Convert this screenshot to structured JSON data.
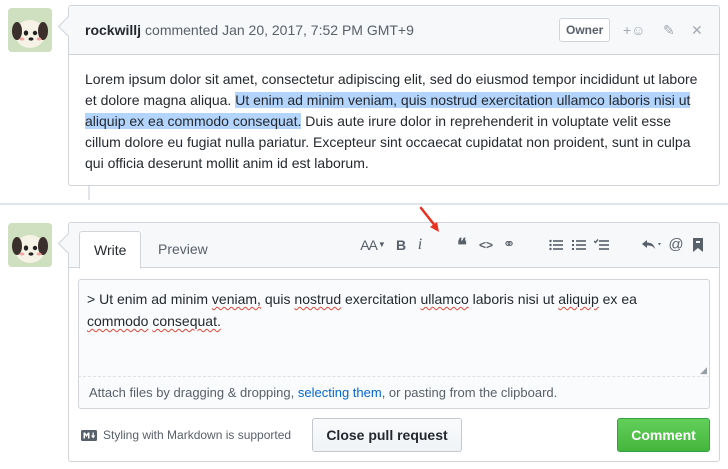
{
  "comment": {
    "author": "rockwillj",
    "meta": "commented Jan 20, 2017, 7:52 PM GMT+9",
    "badge": "Owner",
    "body_before": "Lorem ipsum dolor sit amet, consectetur adipiscing elit, sed do eiusmod tempor incididunt ut labore et dolore magna aliqua. ",
    "body_selected": "Ut enim ad minim veniam, quis nostrud exercitation ullamco laboris nisi ut aliquip ex ea commodo consequat.",
    "body_after": " Duis aute irure dolor in reprehenderit in voluptate velit esse cillum dolore eu fugiat nulla pariatur. Excepteur sint occaecat cupidatat non proident, sunt in culpa qui officia deserunt mollit anim id est laborum.",
    "actions": [
      "add-reaction",
      "edit",
      "delete"
    ],
    "reaction_glyph": "+☺",
    "edit_glyph": "✎",
    "delete_glyph": "✕"
  },
  "editor": {
    "tabs": [
      {
        "label": "Write",
        "active": true
      },
      {
        "label": "Preview",
        "active": false
      }
    ],
    "toolbar": {
      "header_glyph": "AA",
      "bold_glyph": "B",
      "italic_glyph": "i",
      "quote_glyph": "❝",
      "code_glyph": "<>",
      "link_glyph": "⚭",
      "icons": [
        "text-size",
        "bold",
        "italic",
        "quote",
        "code",
        "link",
        "unordered-list",
        "ordered-list",
        "task-list",
        "reply",
        "mention",
        "bookmark"
      ]
    },
    "textarea": {
      "w": [
        ">",
        "Ut",
        "enim",
        "ad",
        "minim",
        "veniam,",
        "quis",
        "nostrud",
        "exercitation",
        "ullamco",
        "laboris",
        "nisi",
        "ut",
        "aliquip",
        "ex",
        "ea",
        "commodo",
        "consequat."
      ]
    },
    "attach": {
      "before": "Attach files by dragging & dropping, ",
      "link": "selecting them",
      "after": ", or pasting from the clipboard."
    },
    "markdown_note": "Styling with Markdown is supported",
    "close_button": "Close pull request",
    "comment_button": "Comment"
  },
  "colors": {
    "selection": "#b3d4fc",
    "comment_button": "#2cbe4e",
    "arrow": "#e8311f",
    "link": "#0366d6"
  }
}
